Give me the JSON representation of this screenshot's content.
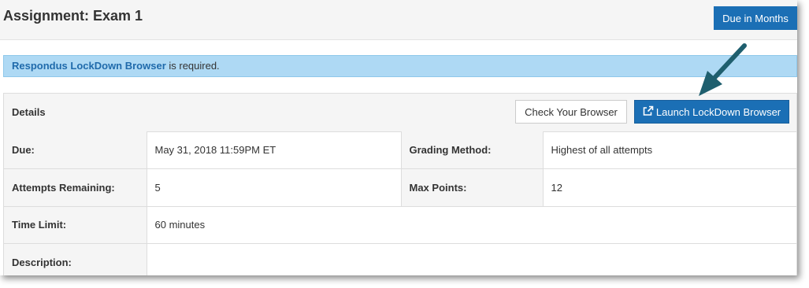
{
  "header": {
    "title": "Assignment: Exam 1",
    "due_button": "Due in Months"
  },
  "alert": {
    "link_text": "Respondus LockDown Browser",
    "suffix": " is required."
  },
  "details": {
    "title": "Details",
    "check_button": "Check Your Browser",
    "launch_button": "Launch LockDown Browser",
    "rows": [
      {
        "label": "Due:",
        "value": "May 31, 2018 11:59PM ET",
        "label2": "Grading Method:",
        "value2": "Highest of all attempts"
      },
      {
        "label": "Attempts Remaining:",
        "value": "5",
        "label2": "Max Points:",
        "value2": "12"
      },
      {
        "label": "Time Limit:",
        "value": "60 minutes"
      },
      {
        "label": "Description:",
        "value": ""
      }
    ]
  },
  "colors": {
    "primary_button": "#1b6fb5",
    "alert_background": "#aed9f4",
    "link": "#1f6aab",
    "annotation_arrow": "#1f5f6e"
  },
  "icons": {
    "launch": "external-link-icon",
    "annotation": "pointer-arrow"
  }
}
